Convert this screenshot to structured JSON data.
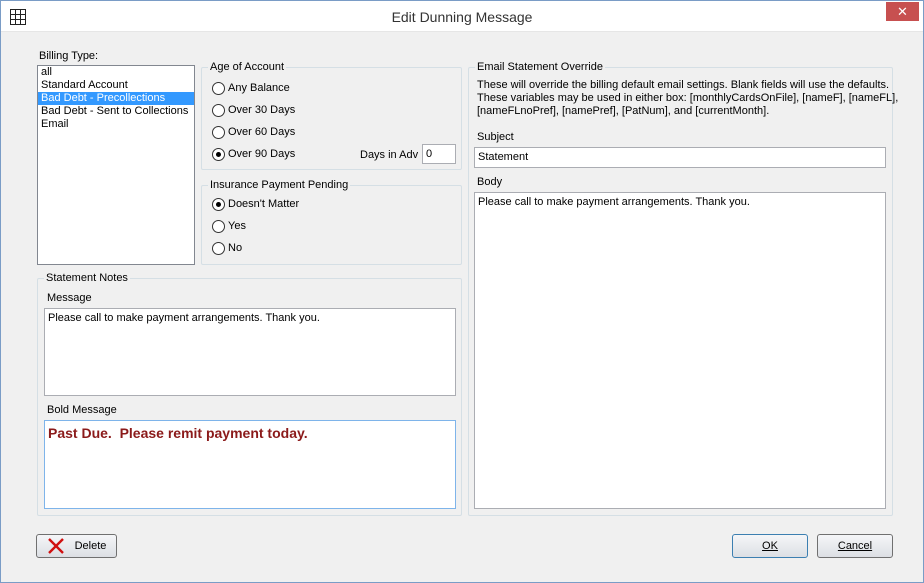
{
  "window": {
    "title": "Edit Dunning Message",
    "close_glyph": "✕"
  },
  "billing_type": {
    "label": "Billing Type:",
    "items": [
      "all",
      "Standard Account",
      "Bad Debt - Precollections",
      "Bad Debt - Sent to Collections",
      "Email"
    ],
    "selected_index": 2
  },
  "age_of_account": {
    "title": "Age of Account",
    "options": [
      "Any Balance",
      "Over 30 Days",
      "Over 60 Days",
      "Over 90 Days"
    ],
    "selected_index": 3,
    "days_in_adv_label": "Days in Adv",
    "days_in_adv_value": "0"
  },
  "insurance_payment": {
    "title": "Insurance Payment Pending",
    "options": [
      "Doesn't Matter",
      "Yes",
      "No"
    ],
    "selected_index": 0
  },
  "statement_notes": {
    "title": "Statement Notes",
    "message_label": "Message",
    "message_value": "Please call to make payment arrangements. Thank you.",
    "bold_label": "Bold Message",
    "bold_value": "Past Due.  Please remit payment today.",
    "bold_color": "#8b1a1a"
  },
  "email_override": {
    "title": "Email Statement Override",
    "description_line1": "These will override the billing default email settings.  Blank fields will use the defaults.",
    "description_line2": "These variables may be used in either box:  [monthlyCardsOnFile], [nameF], [nameFL],",
    "description_line3": "[nameFLnoPref],  [namePref], [PatNum], and [currentMonth].",
    "subject_label": "Subject",
    "subject_value": "Statement",
    "body_label": "Body",
    "body_value": "Please call to make payment arrangements. Thank you."
  },
  "buttons": {
    "delete_label": "Delete",
    "ok_label": "OK",
    "cancel_label": "Cancel"
  },
  "icons": {
    "app": "grid-icon",
    "delete": "red-x-icon"
  }
}
